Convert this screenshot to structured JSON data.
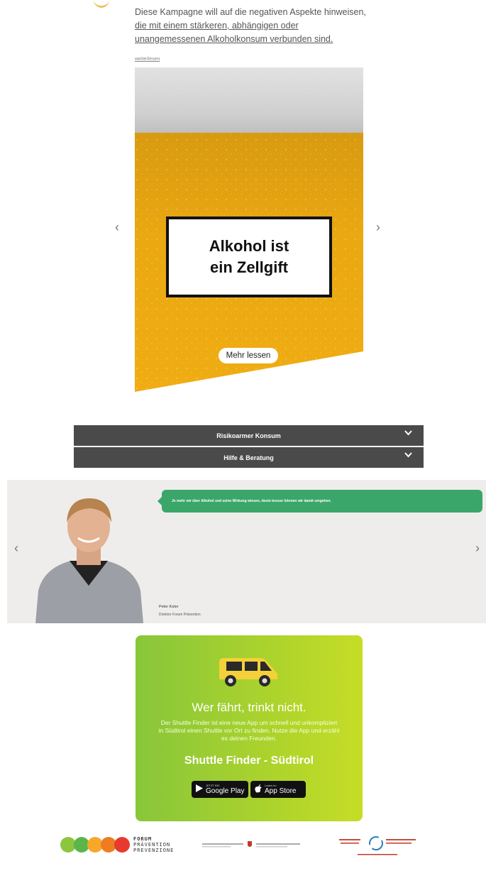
{
  "intro": {
    "line1": "Diese Kampagne will auf die negativen Aspekte hinweisen,",
    "line2": "die mit einem stärkeren, abhängigen oder",
    "line3": "unangemessenen Alkoholkonsum verbunden sind.",
    "more_link": "weiterlesen"
  },
  "carousel": {
    "slide_text": "Alkohol ist\nein Zellgift",
    "button": "Mehr lessen",
    "prev": "‹",
    "next": "›"
  },
  "accordion": [
    {
      "label": "Risikoarmer Konsum"
    },
    {
      "label": "Hilfe & Beratung"
    }
  ],
  "testimonial": {
    "quote": "Je mehr wir über Alkohol und seine Wirkung wissen, desto besser können wir damit umgehen.",
    "name": "Peter Koler",
    "role": "Direktor Forum Prävention",
    "prev": "‹",
    "next": "›"
  },
  "shuttle": {
    "title": "Wer fährt, trinkt nicht.",
    "text": "Der Shuttle Finder ist eine neue App um schnell und unkompliziert in Südtirol einen Shuttle vor Ort zu finden. Nutze die App und erzähl es deinen Freunden.",
    "subtitle": "Shuttle Finder - Südtirol",
    "google_small": "JETZT BEI",
    "google": "Google Play",
    "apple_small": "Laden im",
    "apple": "App Store"
  },
  "footer": {
    "forum_lines": [
      "FORUM",
      "PRÄVENTION",
      "PREVENZIONE"
    ]
  },
  "colors": {
    "accordion_bg": "#4a4a4a",
    "bubble_green": "#3aa66a",
    "beer_gold": "#e9a411",
    "shuttle_green": "#a9d22d"
  },
  "icons": [
    "chevron-left-icon",
    "chevron-right-icon",
    "chevron-down-icon",
    "van-icon",
    "google-play-icon",
    "apple-icon"
  ]
}
